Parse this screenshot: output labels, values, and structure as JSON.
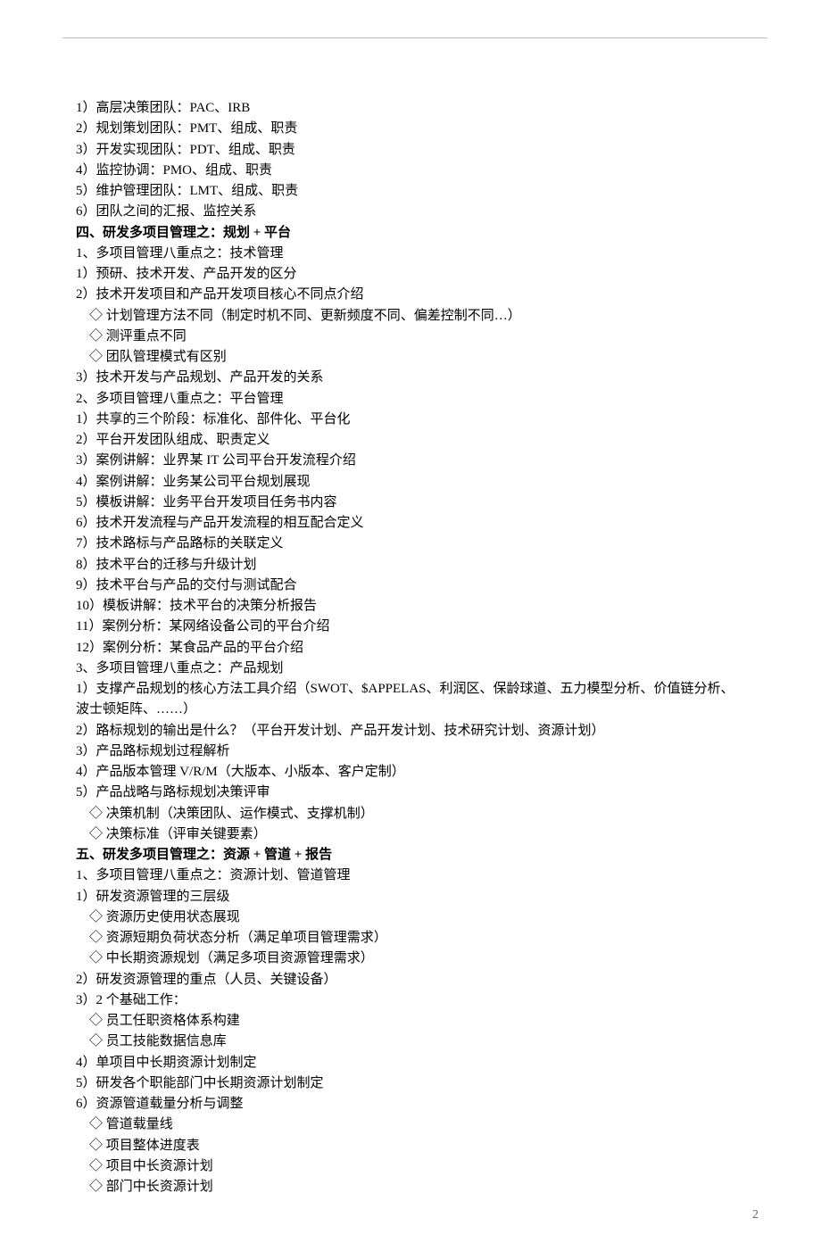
{
  "lines": [
    {
      "cls": "",
      "text": "1）高层决策团队：PAC、IRB"
    },
    {
      "cls": "",
      "text": "2）规划策划团队：PMT、组成、职责"
    },
    {
      "cls": "",
      "text": "3）开发实现团队：PDT、组成、职责"
    },
    {
      "cls": "",
      "text": "4）监控协调：PMO、组成、职责"
    },
    {
      "cls": "",
      "text": "5）维护管理团队：LMT、组成、职责"
    },
    {
      "cls": "",
      "text": "6）团队之间的汇报、监控关系"
    },
    {
      "cls": "heading",
      "text": "四、研发多项目管理之：规划 + 平台"
    },
    {
      "cls": "",
      "text": "1、多项目管理八重点之：技术管理"
    },
    {
      "cls": "",
      "text": "1）预研、技术开发、产品开发的区分"
    },
    {
      "cls": "",
      "text": "2）技术开发项目和产品开发项目核心不同点介绍"
    },
    {
      "cls": "indent1",
      "text": "◇ 计划管理方法不同（制定时机不同、更新频度不同、偏差控制不同…）"
    },
    {
      "cls": "indent1",
      "text": "◇ 测评重点不同"
    },
    {
      "cls": "indent1",
      "text": "◇ 团队管理模式有区别"
    },
    {
      "cls": "",
      "text": "3）技术开发与产品规划、产品开发的关系"
    },
    {
      "cls": "",
      "text": "2、多项目管理八重点之：平台管理"
    },
    {
      "cls": "",
      "text": "1）共享的三个阶段：标准化、部件化、平台化"
    },
    {
      "cls": "",
      "text": "2）平台开发团队组成、职责定义"
    },
    {
      "cls": "",
      "text": "3）案例讲解：业界某 IT 公司平台开发流程介绍"
    },
    {
      "cls": "",
      "text": "4）案例讲解：业务某公司平台规划展现"
    },
    {
      "cls": "",
      "text": "5）模板讲解：业务平台开发项目任务书内容"
    },
    {
      "cls": "",
      "text": "6）技术开发流程与产品开发流程的相互配合定义"
    },
    {
      "cls": "",
      "text": "7）技术路标与产品路标的关联定义"
    },
    {
      "cls": "",
      "text": "8）技术平台的迁移与升级计划"
    },
    {
      "cls": "",
      "text": "9）技术平台与产品的交付与测试配合"
    },
    {
      "cls": "",
      "text": "10）模板讲解：技术平台的决策分析报告"
    },
    {
      "cls": "",
      "text": "11）案例分析：某网络设备公司的平台介绍"
    },
    {
      "cls": "",
      "text": "12）案例分析：某食品产品的平台介绍"
    },
    {
      "cls": "",
      "text": "3、多项目管理八重点之：产品规划"
    },
    {
      "cls": "",
      "text": "1）支撑产品规划的核心方法工具介绍（SWOT、$APPELAS、利润区、保龄球道、五力模型分析、价值链分析、"
    },
    {
      "cls": "",
      "text": "波士顿矩阵、……）"
    },
    {
      "cls": "",
      "text": "2）路标规划的输出是什么？（平台开发计划、产品开发计划、技术研究计划、资源计划）"
    },
    {
      "cls": "",
      "text": "3）产品路标规划过程解析"
    },
    {
      "cls": "",
      "text": "4）产品版本管理 V/R/M（大版本、小版本、客户定制）"
    },
    {
      "cls": "",
      "text": "5）产品战略与路标规划决策评审"
    },
    {
      "cls": "indent1",
      "text": "◇ 决策机制（决策团队、运作模式、支撑机制）"
    },
    {
      "cls": "indent1",
      "text": "◇ 决策标准（评审关键要素）"
    },
    {
      "cls": "heading",
      "text": "五、研发多项目管理之：资源 + 管道 + 报告"
    },
    {
      "cls": "",
      "text": "1、多项目管理八重点之：资源计划、管道管理"
    },
    {
      "cls": "",
      "text": "1）研发资源管理的三层级"
    },
    {
      "cls": "indent1",
      "text": "◇ 资源历史使用状态展现"
    },
    {
      "cls": "indent1",
      "text": "◇ 资源短期负荷状态分析（满足单项目管理需求）"
    },
    {
      "cls": "indent1",
      "text": "◇ 中长期资源规划（满足多项目资源管理需求）"
    },
    {
      "cls": "",
      "text": "2）研发资源管理的重点（人员、关键设备）"
    },
    {
      "cls": "",
      "text": "3）2 个基础工作："
    },
    {
      "cls": "indent1",
      "text": "◇ 员工任职资格体系构建"
    },
    {
      "cls": "indent1",
      "text": "◇ 员工技能数据信息库"
    },
    {
      "cls": "",
      "text": "4）单项目中长期资源计划制定"
    },
    {
      "cls": "",
      "text": "5）研发各个职能部门中长期资源计划制定"
    },
    {
      "cls": "",
      "text": "6）资源管道载量分析与调整"
    },
    {
      "cls": "indent1",
      "text": "◇ 管道载量线"
    },
    {
      "cls": "indent1",
      "text": "◇ 项目整体进度表"
    },
    {
      "cls": "indent1",
      "text": "◇ 项目中长资源计划"
    },
    {
      "cls": "indent1",
      "text": "◇ 部门中长资源计划"
    }
  ],
  "pageNumber": "2"
}
